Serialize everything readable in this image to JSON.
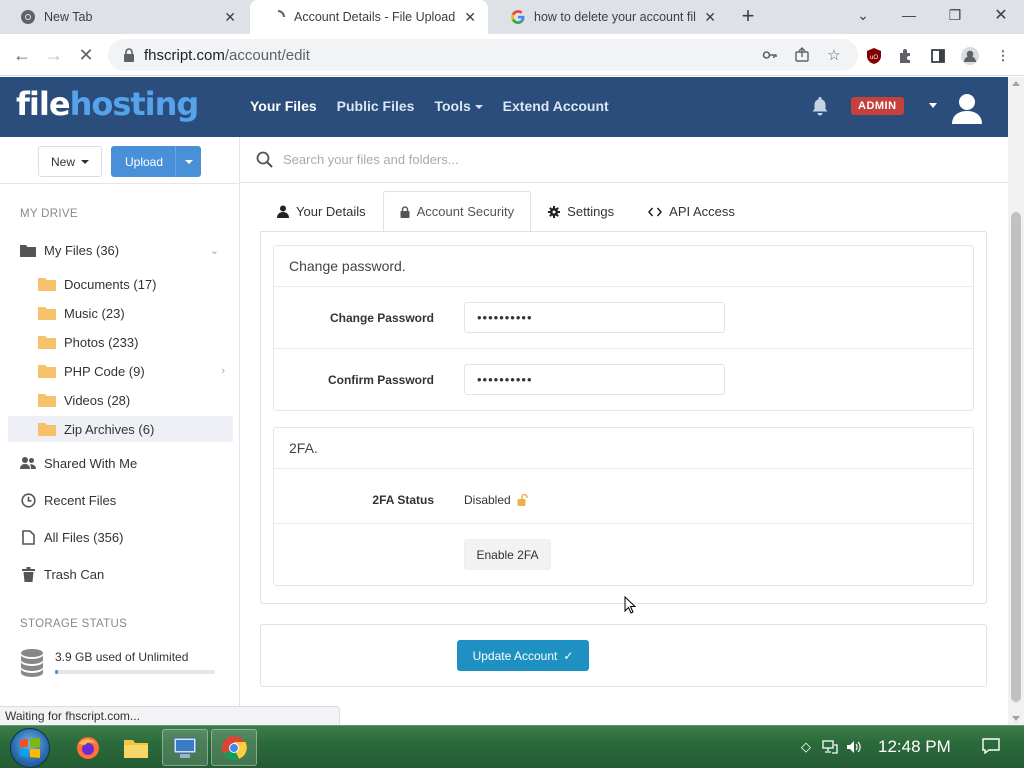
{
  "browser": {
    "tabs": [
      {
        "title": "New Tab"
      },
      {
        "title": "Account Details - File Upload Sc"
      },
      {
        "title": "how to delete your account filel"
      }
    ],
    "url_host": "fhscript.com",
    "url_path": "/account/edit",
    "status_text": "Waiting for fhscript.com..."
  },
  "header": {
    "logo_part1": "file",
    "logo_part2": "hosting",
    "nav": [
      "Your Files",
      "Public Files",
      "Tools",
      "Extend Account"
    ],
    "admin_badge": "ADMIN"
  },
  "sidebar": {
    "new_label": "New",
    "upload_label": "Upload",
    "my_drive_label": "MY DRIVE",
    "my_files": "My Files (36)",
    "folders": [
      "Documents (17)",
      "Music (23)",
      "Photos (233)",
      "PHP Code (9)",
      "Videos (28)",
      "Zip Archives (6)"
    ],
    "shared": "Shared With Me",
    "recent": "Recent Files",
    "all_files": "All Files (356)",
    "trash": "Trash Can",
    "storage_label": "STORAGE STATUS",
    "storage_text": "3.9 GB used of Unlimited"
  },
  "main": {
    "search_placeholder": "Search your files and folders...",
    "tabs": [
      "Your Details",
      "Account Security",
      "Settings",
      "API Access"
    ],
    "password_card": {
      "title": "Change password.",
      "change_label": "Change Password",
      "change_value": "••••••••••",
      "confirm_label": "Confirm Password",
      "confirm_value": "••••••••••"
    },
    "twofa_card": {
      "title": "2FA.",
      "status_label": "2FA Status",
      "status_value": "Disabled",
      "enable_button": "Enable 2FA"
    },
    "update_button": "Update Account"
  },
  "taskbar": {
    "clock": "12:48 PM"
  },
  "colors": {
    "header_bg": "#2a4d7c",
    "logo_accent": "#56a3ec",
    "admin_badge": "#c7413c",
    "upload_btn": "#4a90d9",
    "update_btn": "#1e90c2"
  }
}
